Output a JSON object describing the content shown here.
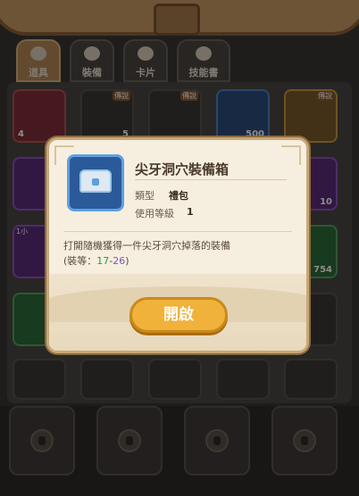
{
  "tabs": [
    {
      "label": "道具",
      "icon": "clover-icon",
      "active": true
    },
    {
      "label": "裝備",
      "icon": "flower-icon",
      "active": false
    },
    {
      "label": "卡片",
      "icon": "card-icon",
      "active": false
    },
    {
      "label": "技能書",
      "icon": "book-icon",
      "active": false
    }
  ],
  "grid_badges": {
    "b1": "4",
    "b2": "5",
    "b3": "500",
    "b4": "10",
    "b5": "754",
    "tag1": "傳說",
    "tag2": "傳說",
    "tag3": "傳說",
    "tag4": "1小"
  },
  "modal": {
    "title": "尖牙洞穴裝備箱",
    "type_label": "類型",
    "type_value": "禮包",
    "level_label": "使用等級",
    "level_value": "1",
    "description": "打開隨機獲得一件尖牙洞穴掉落的裝備",
    "level_range_prefix": "(裝等：",
    "level_min": "17",
    "level_dash": "-",
    "level_max": "26",
    "level_range_suffix": ")",
    "open_button": "開啟",
    "item_icon": "treasure-chest-icon"
  }
}
